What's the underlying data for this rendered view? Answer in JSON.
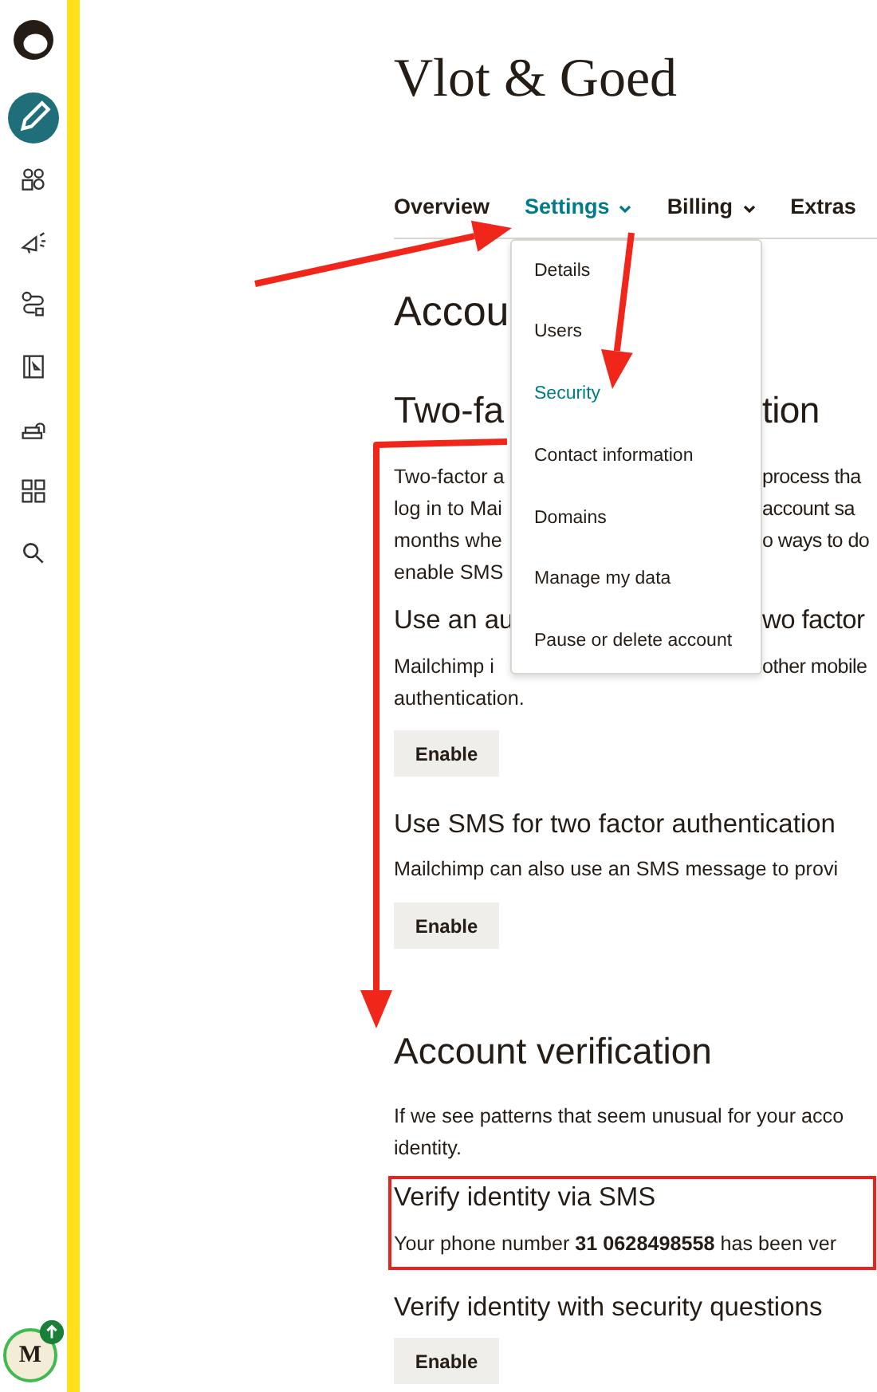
{
  "sidebar": {
    "items": [
      {
        "kind": "logo",
        "selected": false
      },
      {
        "kind": "pencil",
        "selected": true
      },
      {
        "kind": "audience",
        "selected": false
      },
      {
        "kind": "megaphone",
        "selected": false
      },
      {
        "kind": "automation",
        "selected": false
      },
      {
        "kind": "website",
        "selected": false
      },
      {
        "kind": "integrations",
        "selected": false
      },
      {
        "kind": "grid",
        "selected": false
      },
      {
        "kind": "search",
        "selected": false
      }
    ],
    "avatar": {
      "initial": "M",
      "badge": true
    }
  },
  "title": "Vlot & Goed",
  "tabs": [
    {
      "label": "Overview",
      "selected": false,
      "dropdown": false
    },
    {
      "label": "Settings",
      "selected": true,
      "dropdown": true
    },
    {
      "label": "Billing",
      "selected": false,
      "dropdown": true
    },
    {
      "label": "Extras",
      "selected": false,
      "dropdown": false
    }
  ],
  "menu": [
    {
      "label": "Details",
      "selected": false
    },
    {
      "label": "Users",
      "selected": false
    },
    {
      "label": "Security",
      "selected": true
    },
    {
      "label": "Contact information",
      "selected": false
    },
    {
      "label": "Domains",
      "selected": false
    },
    {
      "label": "Manage my data",
      "selected": false
    },
    {
      "label": "Pause or delete account",
      "selected": false
    }
  ],
  "lines": [
    {
      "kind": "h1",
      "left": "Accou"
    },
    {
      "kind": "h2",
      "left": "Two-fa",
      "right": "tion"
    },
    {
      "kind": "p",
      "left": "Two-factor a",
      "right": "process tha"
    },
    {
      "kind": "p",
      "left": "log in to Mai",
      "right": "account sa"
    },
    {
      "kind": "p",
      "left": "months whe",
      "right": "o ways to do"
    },
    {
      "kind": "p",
      "left": "enable SMS"
    },
    {
      "kind": "h3",
      "left": "Use an au",
      "right": "wo factor"
    },
    {
      "kind": "p",
      "left": "Mailchimp i",
      "right": "other mobile"
    },
    {
      "kind": "p",
      "left": "authentication."
    },
    {
      "kind": "button",
      "left": "Enable"
    },
    {
      "kind": "h3",
      "left": "Use SMS for two factor authentication"
    },
    {
      "kind": "p",
      "left": "Mailchimp can also use an SMS message to provi"
    },
    {
      "kind": "button",
      "left": "Enable"
    },
    {
      "kind": "h2",
      "left": "Account verification"
    },
    {
      "kind": "p",
      "left": "If we see patterns that seem unusual for your acco"
    },
    {
      "kind": "p",
      "left": "identity."
    },
    {
      "kind": "h3",
      "left": "Verify identity via SMS"
    },
    {
      "kind": "p",
      "left": "Your phone number **31 0628498558** has been ver"
    },
    {
      "kind": "h3",
      "left": "Verify identity with security questions"
    },
    {
      "kind": "button",
      "left": "Enable"
    }
  ],
  "annotations": [
    {
      "kind": "arrow"
    },
    {
      "kind": "arrow"
    },
    {
      "kind": "arrow"
    },
    {
      "kind": "frame"
    }
  ]
}
